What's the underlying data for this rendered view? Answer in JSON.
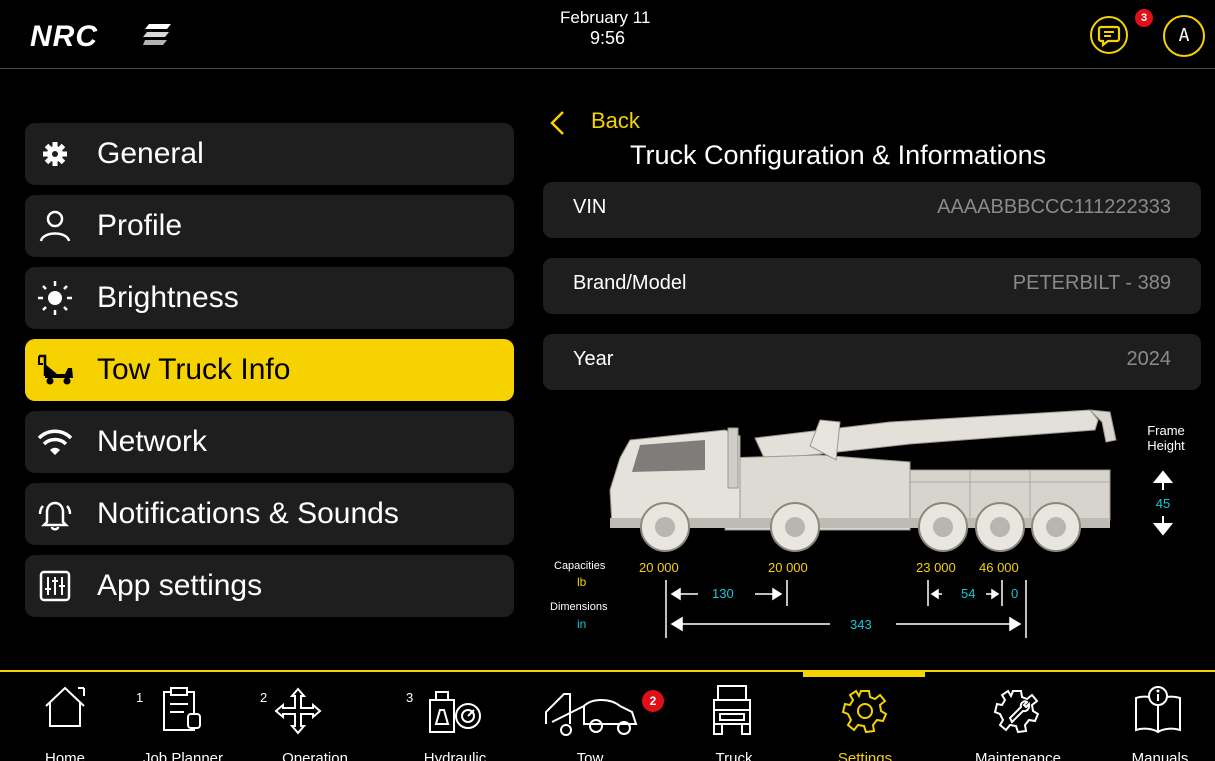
{
  "header": {
    "logo": "NRC",
    "date": "February 11",
    "time": "9:56",
    "messages_badge": "3",
    "avatar_initial": "A"
  },
  "menu": {
    "items": [
      {
        "label": "General",
        "icon": "gear-icon"
      },
      {
        "label": "Profile",
        "icon": "user-icon"
      },
      {
        "label": "Brightness",
        "icon": "sun-icon"
      },
      {
        "label": "Tow Truck Info",
        "icon": "tow-truck-icon",
        "active": true
      },
      {
        "label": "Network",
        "icon": "wifi-icon"
      },
      {
        "label": "Notifications & Sounds",
        "icon": "bell-icon"
      },
      {
        "label": "App settings",
        "icon": "sliders-icon"
      }
    ]
  },
  "panel": {
    "back_label": "Back",
    "title": "Truck Configuration & Informations",
    "fields": [
      {
        "key": "VIN",
        "value": "AAAABBBCCC111222333"
      },
      {
        "key": "Brand/Model",
        "value": "PETERBILT - 389"
      },
      {
        "key": "Year",
        "value": "2024"
      }
    ]
  },
  "diagram": {
    "capacities_label": "Capacities",
    "capacities_unit": "lb",
    "dimensions_label": "Dimensions",
    "dimensions_unit": "in",
    "capacities": [
      "20 000",
      "20 000",
      "23 000",
      "46 000"
    ],
    "dimensions": {
      "wheelbase": "130",
      "axle1": "54",
      "axle2": "0",
      "total": "343"
    },
    "frame_height_label": "Frame Height",
    "frame_height": "45"
  },
  "bottom_nav": {
    "items": [
      {
        "label": "Home",
        "icon": "home-icon"
      },
      {
        "label": "Job Planner",
        "num": "1",
        "icon": "clipboard-icon"
      },
      {
        "label": "Operation",
        "num": "2",
        "icon": "move-arrows-icon"
      },
      {
        "label": "Hydraulic",
        "num": "3",
        "icon": "hydraulic-gauge-icon"
      },
      {
        "label": "Tow",
        "icon": "tow-car-icon",
        "badge": "2"
      },
      {
        "label": "Truck",
        "icon": "truck-icon"
      },
      {
        "label": "Settings",
        "icon": "settings-gear-icon",
        "active": true
      },
      {
        "label": "Maintenance",
        "icon": "maintenance-gear-icon"
      },
      {
        "label": "Manuals",
        "icon": "manual-book-icon"
      }
    ]
  },
  "colors": {
    "accent": "#f5d200",
    "cyan": "#16c8d8",
    "badge": "#e0101a",
    "card": "#1e1e1e"
  }
}
